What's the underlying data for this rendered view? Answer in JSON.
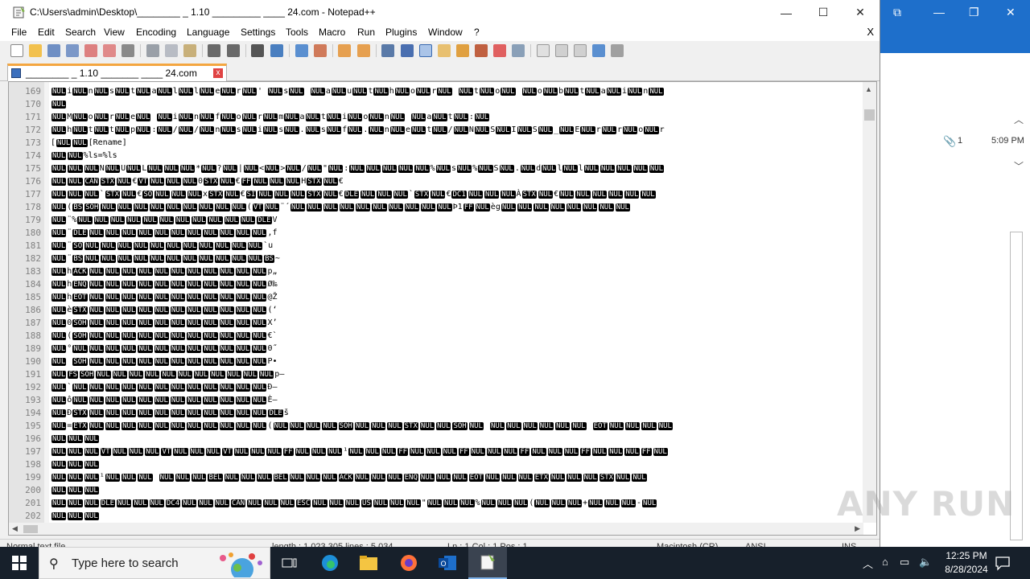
{
  "window": {
    "title": "C:\\Users\\admin\\Desktop\\________ _ 1.10 _________ ____ 24.com - Notepad++",
    "minimize": "—",
    "maximize": "☐",
    "close": "✕"
  },
  "menu": {
    "items": [
      "File",
      "Edit",
      "Search",
      "View",
      "Encoding",
      "Language",
      "Settings",
      "Tools",
      "Macro",
      "Run",
      "Plugins",
      "Window",
      "?"
    ],
    "close": "X"
  },
  "tab": {
    "label": "________ _ 1.10 _______ ____ 24.com",
    "close": "x"
  },
  "editor": {
    "lines": [
      {
        "num": "169",
        "text": "[NUL]i[NUL]n[NUL]s[NUL]t[NUL]a[NUL]l[NUL]l[NUL]e[NUL]r[NUL]' [NUL]s[NUL] [NUL]a[NUL]u[NUL]t[NUL]h[NUL]o[NUL]r[NUL] [NUL]t[NUL]o[NUL] [NUL]o[NUL]b[NUL]t[NUL]a[NUL]i[NUL]n[NUL]"
      },
      {
        "num": "170",
        "text": "[NUL]"
      },
      {
        "num": "171",
        "text": "[NUL]M[NUL]o[NUL]r[NUL]e[NUL] [NUL]i[NUL]n[NUL]f[NUL]o[NUL]r[NUL]m[NUL]a[NUL]t[NUL]i[NUL]o[NUL]n[NUL] [NUL]a[NUL]t[NUL]:[NUL]"
      },
      {
        "num": "172",
        "text": "[NUL]h[NUL]t[NUL]t[NUL]p[NUL]:[NUL]/[NUL]/[NUL]n[NUL]s[NUL]i[NUL]s[NUL].[NUL]s[NUL]f[NUL].[NUL]n[NUL]e[NUL]t[NUL]/[NUL]N[NUL]S[NUL]I[NUL]S[NUL]_[NUL]E[NUL]r[NUL]r[NUL]o[NUL]r"
      },
      {
        "num": "173",
        "text": "[[NUL][NUL][Rename]"
      },
      {
        "num": "174",
        "text": "[NUL][NUL]%ls=%ls"
      },
      {
        "num": "175",
        "text": "[NUL][NUL][NUL]N[NUL]U[NUL]L[NUL][NUL][NUL]*[NUL]?[NUL]|[NUL]<[NUL]>[NUL]/[NUL]\"[NUL]:[NUL][NUL][NUL][NUL][NUL]%[NUL]s[NUL]%[NUL]S[NUL].[NUL]d[NUL]l[NUL]l[NUL][NUL][NUL][NUL][NUL]"
      },
      {
        "num": "176",
        "text": "[NUL][NUL][CAN][STX][NUL]€[VT][NUL][NUL][NUL]0[STX][NUL]€[FF][NUL][NUL][NUL]H[STX][NUL]€"
      },
      {
        "num": "177",
        "text": "[NUL][NUL][NUL]`[STX][NUL]€[SO][NUL][NUL][NUL]x[STX][NUL]€[SI][NUL][NUL][NUL][STX][NUL]€[DLE][NUL][NUL][NUL]`[STX][NUL]€[DC1][NUL][NUL][NUL]À[STX][NUL]€[NUL][NUL][NUL][NUL][NUL][NUL]"
      },
      {
        "num": "178",
        "text": "[NUL]([BS][SOH][NUL][NUL][NUL][NUL][NUL][NUL][NUL][NUL][NUL]([VT][NUL]¨´[NUL][NUL][NUL][NUL][NUL][NUL][NUL][NUL][NUL][NUL]Þ1[FF][NUL]èg[NUL][NUL][NUL][NUL][NUL][NUL][NUL][NUL]"
      },
      {
        "num": "179",
        "text": "[NUL]¨%[NUL][NUL][NUL][NUL][NUL][NUL][NUL][NUL][NUL][NUL][NUL][DLE]V"
      },
      {
        "num": "180",
        "text": "[NUL]¨[DLE][NUL][NUL][NUL][NUL][NUL][NUL][NUL][NUL][NUL][NUL][NUL],f"
      },
      {
        "num": "181",
        "text": "[NUL]¨[SO][NUL][NUL][NUL][NUL][NUL][NUL][NUL][NUL][NUL][NUL][NUL]`u"
      },
      {
        "num": "182",
        "text": "[NUL]¨[BS][NUL][NUL][NUL][NUL][NUL][NUL][NUL][NUL][NUL][NUL][NUL][BS]~"
      },
      {
        "num": "183",
        "text": "[NUL]h[ACK][NUL][NUL][NUL][NUL][NUL][NUL][NUL][NUL][NUL][NUL][NUL]p„"
      },
      {
        "num": "184",
        "text": "[NUL]h[ENQ][NUL][NUL][NUL][NUL][NUL][NUL][NUL][NUL][NUL][NUL][NUL]Ø‰"
      },
      {
        "num": "185",
        "text": "[NUL]h[EOT][NUL][NUL][NUL][NUL][NUL][NUL][NUL][NUL][NUL][NUL][NUL]@Ž"
      },
      {
        "num": "186",
        "text": "[NUL]è[STX][NUL][NUL][NUL][NUL][NUL][NUL][NUL][NUL][NUL][NUL][NUL](‘"
      },
      {
        "num": "187",
        "text": "[NUL]0[SOH][NUL][NUL][NUL][NUL][NUL][NUL][NUL][NUL][NUL][NUL][NUL]X’"
      },
      {
        "num": "188",
        "text": "[NUL]([SOH][NUL][NUL][NUL][NUL][NUL][NUL][NUL][NUL][NUL][NUL][NUL]€`"
      },
      {
        "num": "189",
        "text": "[NUL]°[NUL][NUL][NUL][NUL][NUL][NUL][NUL][NUL][NUL][NUL][NUL][NUL]0˝"
      },
      {
        "num": "190",
        "text": "[NUL] [SOH][NUL][NUL][NUL][NUL][NUL][NUL][NUL][NUL][NUL][NUL][NUL]P•"
      },
      {
        "num": "191",
        "text": "[NUL][FS][SOH][NUL][NUL][NUL][NUL][NUL][NUL][NUL][NUL][NUL][NUL][NUL]p–"
      },
      {
        "num": "192",
        "text": "[NUL]`[NUL][NUL][NUL][NUL][NUL][NUL][NUL][NUL][NUL][NUL][NUL][NUL]Ð–"
      },
      {
        "num": "193",
        "text": "[NUL]ô[NUL][NUL][NUL][NUL][NUL][NUL][NUL][NUL][NUL][NUL][NUL][NUL]È—"
      },
      {
        "num": "194",
        "text": "[NUL]Ð[STX][NUL][NUL][NUL][NUL][NUL][NUL][NUL][NUL][NUL][NUL][NUL][DLE]š"
      },
      {
        "num": "195",
        "text": "[NUL]=[ETX][NUL][NUL][NUL][NUL][NUL][NUL][NUL][NUL][NUL][NUL][NUL]([NUL][NUL][NUL][NUL][SOH][NUL][NUL][NUL][STX][NUL][NUL][SOH][NUL] [NUL][NUL][NUL][NUL][NUL][NUL] [EOT][NUL][NUL][NUL][NUL]"
      },
      {
        "num": "196",
        "text": "[NUL][NUL][NUL]"
      },
      {
        "num": "197",
        "text": "[NUL][NUL][NUL][VT][NUL][NUL][NUL][VT][NUL][NUL][NUL][VT][NUL][NUL][NUL][FF][NUL][NUL][NUL]¹[NUL][NUL][NUL][FF][NUL][NUL][NUL][FF][NUL][NUL][NUL][FF][NUL][NUL][NUL][FF][NUL][NUL][NUL][FF][NUL]"
      },
      {
        "num": "198",
        "text": "[NUL][NUL][NUL]"
      },
      {
        "num": "199",
        "text": "[NUL][NUL][NUL]¹[NUL][NUL][NUL]   [NUL][NUL][NUL][BEL][NUL][NUL][NUL][BEL][NUL][NUL][NUL][ACK][NUL][NUL][NUL][ENQ][NUL][NUL][NUL][EOT][NUL][NUL][NUL][ETX][NUL][NUL][NUL][STX][NUL][NUL]"
      },
      {
        "num": "200",
        "text": "[NUL][NUL][NUL]"
      },
      {
        "num": "201",
        "text": "[NUL][NUL][NUL][DLE][NUL][NUL][NUL][DC4][NUL][NUL][NUL][CAN][NUL][NUL][NUL][ESC][NUL][NUL][NUL][US][NUL][NUL][NUL]\"[NUL][NUL][NUL]%[NUL][NUL][NUL]([NUL][NUL][NUL]+[NUL][NUL][NUL]-[NUL]"
      },
      {
        "num": "202",
        "text": "[NUL][NUL][NUL]"
      }
    ]
  },
  "statusbar": {
    "type": "Normal text file",
    "length": "length : 1,023,305    lines : 5,034",
    "position": "Ln : 1    Col : 1    Pos : 1",
    "eol": "Macintosh (CR)",
    "encoding": "ANSI",
    "mode": "INS"
  },
  "outlook": {
    "attach_count": "1",
    "time": "5:09 PM"
  },
  "watermark": "ANY RUN",
  "taskbar": {
    "search_placeholder": "Type here to search",
    "time": "12:25 PM",
    "date": "8/28/2024"
  }
}
